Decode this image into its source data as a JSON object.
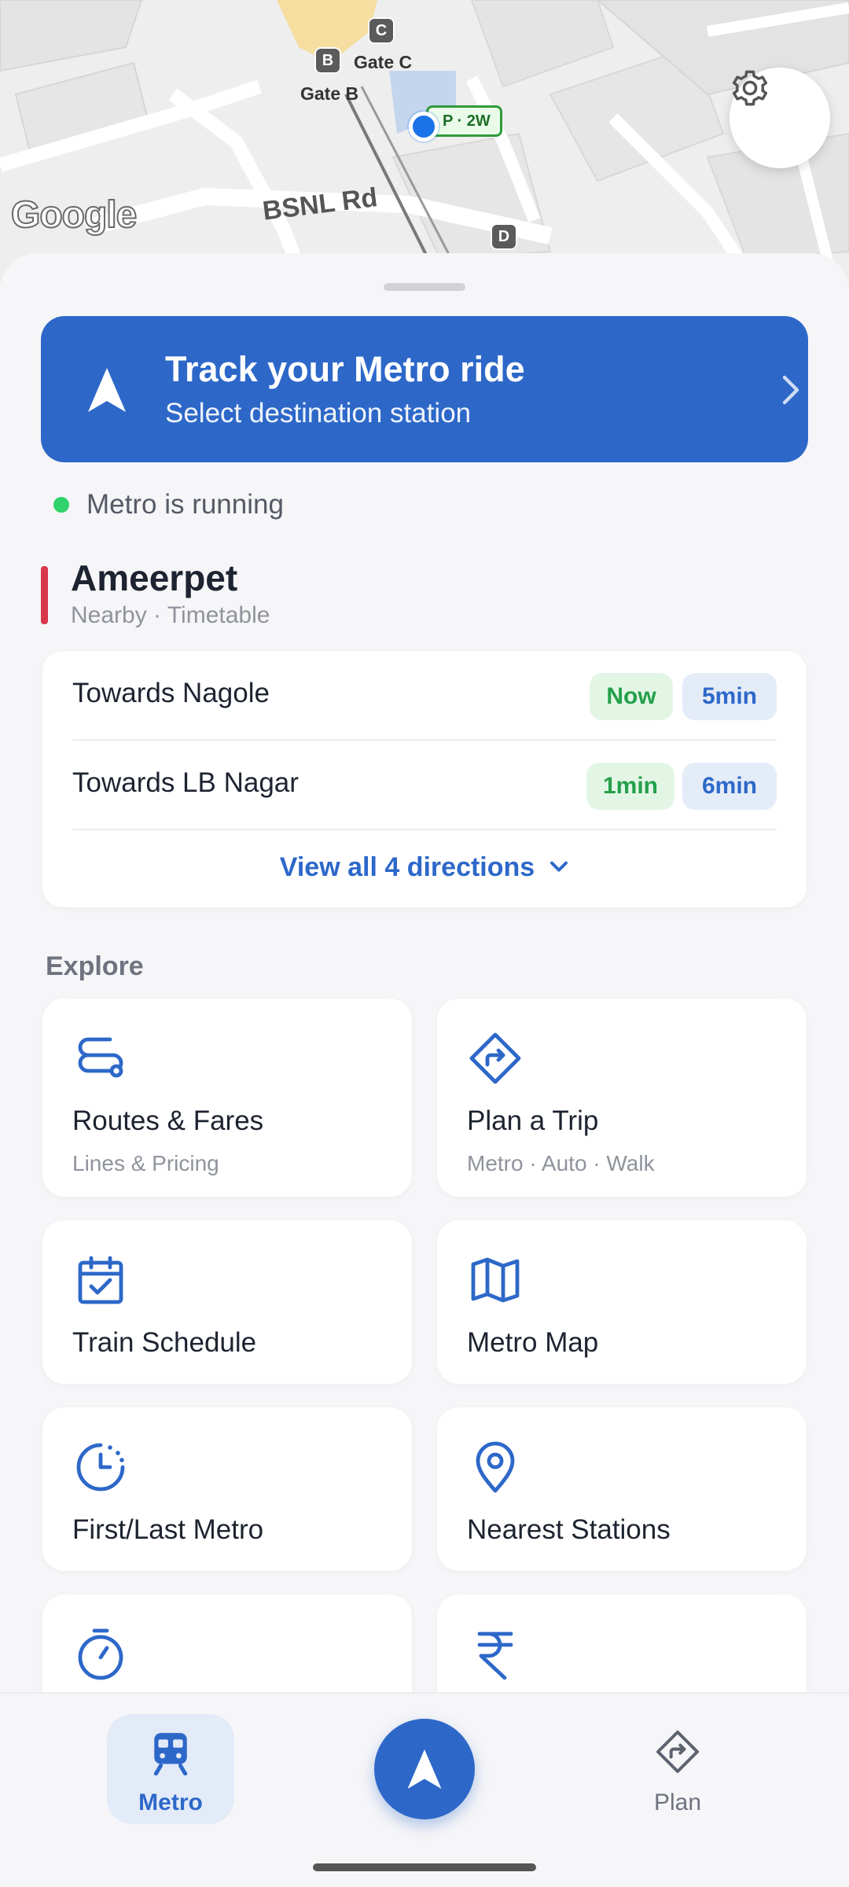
{
  "map": {
    "gate_c_badge": "C",
    "gate_c_label": "Gate C",
    "gate_b_badge": "B",
    "gate_b_label": "Gate B",
    "gate_d_badge": "D",
    "platform_tag": "P · 2W",
    "road_label": "BSNL Rd",
    "logo_text": "Google"
  },
  "track": {
    "title": "Track your Metro ride",
    "subtitle": "Select destination station"
  },
  "status": {
    "text": "Metro is running",
    "color": "#2fd26b"
  },
  "station": {
    "name": "Ameerpet",
    "subtitle": "Nearby · Timetable",
    "accent": "#d9374b"
  },
  "directions": [
    {
      "name": "Towards Nagole",
      "times": [
        "Now",
        "5min"
      ]
    },
    {
      "name": "Towards LB Nagar",
      "times": [
        "1min",
        "6min"
      ]
    }
  ],
  "view_all": "View all 4 directions",
  "explore": {
    "heading": "Explore",
    "tiles": [
      {
        "title": "Routes & Fares",
        "subtitle": "Lines & Pricing",
        "icon": "route-icon"
      },
      {
        "title": "Plan a Trip",
        "subtitle": "Metro · Auto · Walk",
        "icon": "directions-diamond-icon"
      },
      {
        "title": "Train Schedule",
        "subtitle": "",
        "icon": "calendar-check-icon"
      },
      {
        "title": "Metro Map",
        "subtitle": "",
        "icon": "map-icon"
      },
      {
        "title": "First/Last Metro",
        "subtitle": "",
        "icon": "clock-icon"
      },
      {
        "title": "Nearest Stations",
        "subtitle": "",
        "icon": "location-pin-icon"
      },
      {
        "title": "",
        "subtitle": "",
        "icon": "stopwatch-icon"
      },
      {
        "title": "",
        "subtitle": "",
        "icon": "rupee-icon"
      }
    ]
  },
  "nav": {
    "metro_label": "Metro",
    "plan_label": "Plan"
  },
  "colors": {
    "primary": "#2d68c9",
    "green_chip_text": "#24a04a",
    "green_chip_bg": "#e3f6e6",
    "blue_chip_bg": "#e4ecf8"
  }
}
